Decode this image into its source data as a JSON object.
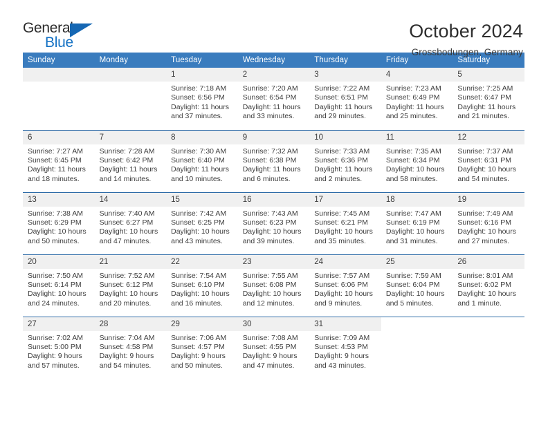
{
  "logo": {
    "word_one": "General",
    "word_two": "Blue",
    "triangle_color": "#1567b3",
    "blue_color": "#1572c4"
  },
  "header": {
    "title": "October 2024",
    "subtitle": "Grossbodungen, Germany"
  },
  "theme": {
    "header_row_bg": "#3a7cbe",
    "row_divider": "#2e6ca8",
    "daynum_bg": "#f0f0f0"
  },
  "weekday_headers": [
    "Sunday",
    "Monday",
    "Tuesday",
    "Wednesday",
    "Thursday",
    "Friday",
    "Saturday"
  ],
  "weeks": [
    [
      {
        "day": "",
        "blank": true
      },
      {
        "day": "",
        "blank": true
      },
      {
        "day": "1",
        "sunrise": "Sunrise: 7:18 AM",
        "sunset": "Sunset: 6:56 PM",
        "daylight": "Daylight: 11 hours and 37 minutes."
      },
      {
        "day": "2",
        "sunrise": "Sunrise: 7:20 AM",
        "sunset": "Sunset: 6:54 PM",
        "daylight": "Daylight: 11 hours and 33 minutes."
      },
      {
        "day": "3",
        "sunrise": "Sunrise: 7:22 AM",
        "sunset": "Sunset: 6:51 PM",
        "daylight": "Daylight: 11 hours and 29 minutes."
      },
      {
        "day": "4",
        "sunrise": "Sunrise: 7:23 AM",
        "sunset": "Sunset: 6:49 PM",
        "daylight": "Daylight: 11 hours and 25 minutes."
      },
      {
        "day": "5",
        "sunrise": "Sunrise: 7:25 AM",
        "sunset": "Sunset: 6:47 PM",
        "daylight": "Daylight: 11 hours and 21 minutes."
      }
    ],
    [
      {
        "day": "6",
        "sunrise": "Sunrise: 7:27 AM",
        "sunset": "Sunset: 6:45 PM",
        "daylight": "Daylight: 11 hours and 18 minutes."
      },
      {
        "day": "7",
        "sunrise": "Sunrise: 7:28 AM",
        "sunset": "Sunset: 6:42 PM",
        "daylight": "Daylight: 11 hours and 14 minutes."
      },
      {
        "day": "8",
        "sunrise": "Sunrise: 7:30 AM",
        "sunset": "Sunset: 6:40 PM",
        "daylight": "Daylight: 11 hours and 10 minutes."
      },
      {
        "day": "9",
        "sunrise": "Sunrise: 7:32 AM",
        "sunset": "Sunset: 6:38 PM",
        "daylight": "Daylight: 11 hours and 6 minutes."
      },
      {
        "day": "10",
        "sunrise": "Sunrise: 7:33 AM",
        "sunset": "Sunset: 6:36 PM",
        "daylight": "Daylight: 11 hours and 2 minutes."
      },
      {
        "day": "11",
        "sunrise": "Sunrise: 7:35 AM",
        "sunset": "Sunset: 6:34 PM",
        "daylight": "Daylight: 10 hours and 58 minutes."
      },
      {
        "day": "12",
        "sunrise": "Sunrise: 7:37 AM",
        "sunset": "Sunset: 6:31 PM",
        "daylight": "Daylight: 10 hours and 54 minutes."
      }
    ],
    [
      {
        "day": "13",
        "sunrise": "Sunrise: 7:38 AM",
        "sunset": "Sunset: 6:29 PM",
        "daylight": "Daylight: 10 hours and 50 minutes."
      },
      {
        "day": "14",
        "sunrise": "Sunrise: 7:40 AM",
        "sunset": "Sunset: 6:27 PM",
        "daylight": "Daylight: 10 hours and 47 minutes."
      },
      {
        "day": "15",
        "sunrise": "Sunrise: 7:42 AM",
        "sunset": "Sunset: 6:25 PM",
        "daylight": "Daylight: 10 hours and 43 minutes."
      },
      {
        "day": "16",
        "sunrise": "Sunrise: 7:43 AM",
        "sunset": "Sunset: 6:23 PM",
        "daylight": "Daylight: 10 hours and 39 minutes."
      },
      {
        "day": "17",
        "sunrise": "Sunrise: 7:45 AM",
        "sunset": "Sunset: 6:21 PM",
        "daylight": "Daylight: 10 hours and 35 minutes."
      },
      {
        "day": "18",
        "sunrise": "Sunrise: 7:47 AM",
        "sunset": "Sunset: 6:19 PM",
        "daylight": "Daylight: 10 hours and 31 minutes."
      },
      {
        "day": "19",
        "sunrise": "Sunrise: 7:49 AM",
        "sunset": "Sunset: 6:16 PM",
        "daylight": "Daylight: 10 hours and 27 minutes."
      }
    ],
    [
      {
        "day": "20",
        "sunrise": "Sunrise: 7:50 AM",
        "sunset": "Sunset: 6:14 PM",
        "daylight": "Daylight: 10 hours and 24 minutes."
      },
      {
        "day": "21",
        "sunrise": "Sunrise: 7:52 AM",
        "sunset": "Sunset: 6:12 PM",
        "daylight": "Daylight: 10 hours and 20 minutes."
      },
      {
        "day": "22",
        "sunrise": "Sunrise: 7:54 AM",
        "sunset": "Sunset: 6:10 PM",
        "daylight": "Daylight: 10 hours and 16 minutes."
      },
      {
        "day": "23",
        "sunrise": "Sunrise: 7:55 AM",
        "sunset": "Sunset: 6:08 PM",
        "daylight": "Daylight: 10 hours and 12 minutes."
      },
      {
        "day": "24",
        "sunrise": "Sunrise: 7:57 AM",
        "sunset": "Sunset: 6:06 PM",
        "daylight": "Daylight: 10 hours and 9 minutes."
      },
      {
        "day": "25",
        "sunrise": "Sunrise: 7:59 AM",
        "sunset": "Sunset: 6:04 PM",
        "daylight": "Daylight: 10 hours and 5 minutes."
      },
      {
        "day": "26",
        "sunrise": "Sunrise: 8:01 AM",
        "sunset": "Sunset: 6:02 PM",
        "daylight": "Daylight: 10 hours and 1 minute."
      }
    ],
    [
      {
        "day": "27",
        "sunrise": "Sunrise: 7:02 AM",
        "sunset": "Sunset: 5:00 PM",
        "daylight": "Daylight: 9 hours and 57 minutes."
      },
      {
        "day": "28",
        "sunrise": "Sunrise: 7:04 AM",
        "sunset": "Sunset: 4:58 PM",
        "daylight": "Daylight: 9 hours and 54 minutes."
      },
      {
        "day": "29",
        "sunrise": "Sunrise: 7:06 AM",
        "sunset": "Sunset: 4:57 PM",
        "daylight": "Daylight: 9 hours and 50 minutes."
      },
      {
        "day": "30",
        "sunrise": "Sunrise: 7:08 AM",
        "sunset": "Sunset: 4:55 PM",
        "daylight": "Daylight: 9 hours and 47 minutes."
      },
      {
        "day": "31",
        "sunrise": "Sunrise: 7:09 AM",
        "sunset": "Sunset: 4:53 PM",
        "daylight": "Daylight: 9 hours and 43 minutes."
      },
      {
        "day": "",
        "empty_tail": true
      },
      {
        "day": "",
        "empty_tail": true
      }
    ]
  ]
}
